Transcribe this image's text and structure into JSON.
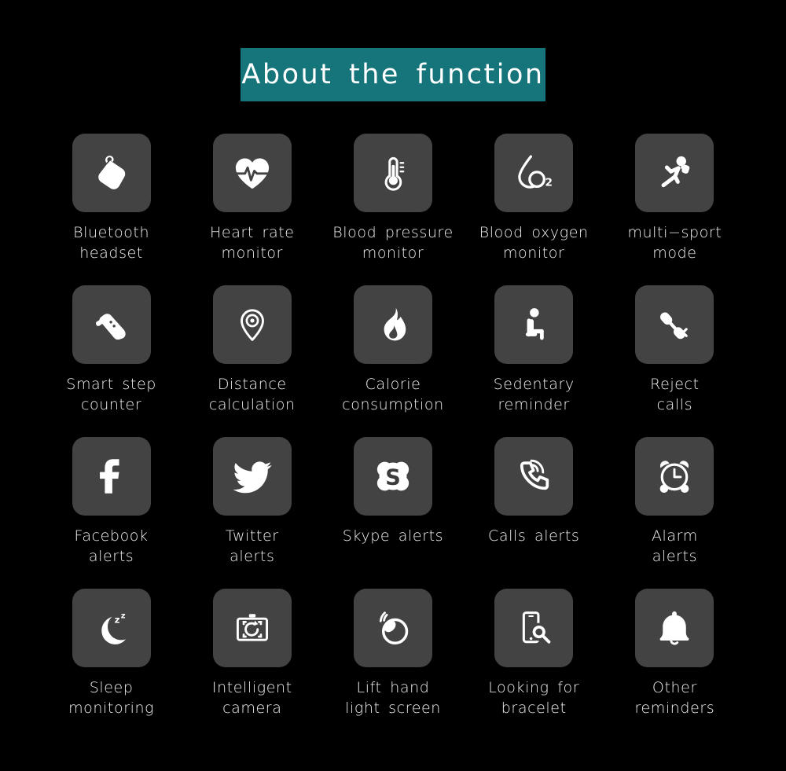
{
  "header": {
    "title": "About  the  function",
    "banner_color": "#15757a",
    "text_color": "#ffffff"
  },
  "theme": {
    "background": "#000000",
    "tile_color": "#434343",
    "label_color": "#f0f0f0",
    "icon_color": "#ffffff"
  },
  "grid": {
    "columns": 5,
    "rows": 4,
    "items": [
      {
        "icon": "whistle-icon",
        "label": "Bluetooth\nheadset"
      },
      {
        "icon": "heart-pulse-icon",
        "label": "Heart rate\nmonitor"
      },
      {
        "icon": "thermometer-icon",
        "label": "Blood pressure\nmonitor"
      },
      {
        "icon": "blood-droplet-o2-icon",
        "label": "Blood oxygen\nmonitor"
      },
      {
        "icon": "running-person-icon",
        "label": "multi−sport\nmode"
      },
      {
        "icon": "shoe-icon",
        "label": "Smart step\ncounter"
      },
      {
        "icon": "location-pin-icon",
        "label": "Distance\ncalculation"
      },
      {
        "icon": "flame-icon",
        "label": "Calorie\nconsumption"
      },
      {
        "icon": "sitting-person-icon",
        "label": "Sedentary\nreminder"
      },
      {
        "icon": "phone-reject-icon",
        "label": "Reject\ncalls"
      },
      {
        "icon": "facebook-icon",
        "label": "Facebook\nalerts"
      },
      {
        "icon": "twitter-bird-icon",
        "label": "Twitter\nalerts"
      },
      {
        "icon": "skype-icon",
        "label": "Skype alerts"
      },
      {
        "icon": "phone-ringing-icon",
        "label": "Calls alerts"
      },
      {
        "icon": "alarm-clock-icon",
        "label": "Alarm\nalerts"
      },
      {
        "icon": "moon-zzz-icon",
        "label": "Sleep\nmonitoring"
      },
      {
        "icon": "camera-rotate-icon",
        "label": "Intelligent\ncamera"
      },
      {
        "icon": "wrist-lift-icon",
        "label": "Lift hand\nlight screen"
      },
      {
        "icon": "phone-search-icon",
        "label": "Looking for\nbracelet"
      },
      {
        "icon": "bell-icon",
        "label": "Other\nreminders"
      }
    ]
  }
}
